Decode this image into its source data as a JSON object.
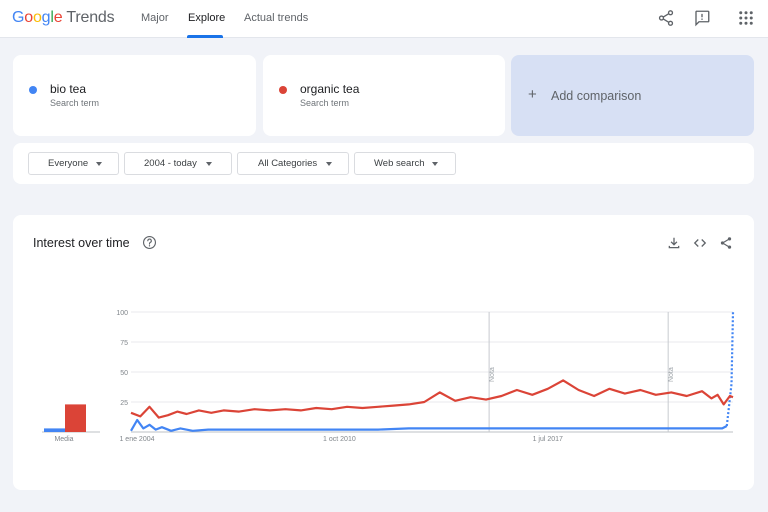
{
  "header": {
    "logo_google": [
      "G",
      "o",
      "o",
      "g",
      "l",
      "e"
    ],
    "logo_trends": "Trends",
    "tabs": [
      "Major",
      "Explore",
      "Actual trends"
    ],
    "active_tab": "Explore",
    "icons": [
      "share-icon",
      "feedback-icon",
      "apps-grid-icon"
    ]
  },
  "terms": [
    {
      "name": "bio tea",
      "sub": "Search term",
      "color": "#4285f4"
    },
    {
      "name": "organic tea",
      "sub": "Search term",
      "color": "#db4437"
    }
  ],
  "add_comparison": {
    "label": "Add comparison",
    "icon": "plus-icon"
  },
  "filters": [
    "Everyone",
    "2004 - today",
    "All Categories",
    "Web search"
  ],
  "chart_card": {
    "title": "Interest over time",
    "icons": [
      "help-icon",
      "download-icon",
      "embed-icon",
      "share-icon"
    ]
  },
  "chart_data": {
    "type": "line",
    "x_tick_labels": [
      "1 ene 2004",
      "1 oct 2010",
      "1 jul 2017"
    ],
    "y_tick_labels": [
      "100",
      "75",
      "50",
      "25"
    ],
    "ylim": [
      0,
      100
    ],
    "xlim": [
      2004.0,
      2023.5
    ],
    "notes": [
      {
        "label": "Nota",
        "x": 2015.6
      },
      {
        "label": "Nota",
        "x": 2021.4
      }
    ],
    "average": {
      "label": "Media",
      "values": [
        3,
        23
      ]
    },
    "series": [
      {
        "name": "bio tea",
        "color": "#4285f4",
        "x": [
          2004.0,
          2004.2,
          2004.4,
          2004.6,
          2004.8,
          2005.0,
          2005.3,
          2005.6,
          2006.0,
          2006.5,
          2007,
          2008,
          2009,
          2010,
          2011,
          2012,
          2013,
          2014,
          2015,
          2016,
          2017,
          2018,
          2019,
          2020,
          2021,
          2022,
          2023.0,
          2023.15,
          2023.3,
          2023.45,
          2023.5
        ],
        "y": [
          1,
          10,
          3,
          6,
          2,
          4,
          1,
          3,
          1,
          2,
          2,
          2,
          2,
          2,
          2,
          2,
          3,
          3,
          3,
          3,
          3,
          3,
          3,
          3,
          3,
          3,
          3,
          3,
          5,
          40,
          100
        ]
      },
      {
        "name": "organic tea",
        "color": "#db4437",
        "x": [
          2004.0,
          2004.3,
          2004.6,
          2004.9,
          2005.2,
          2005.5,
          2005.8,
          2006.2,
          2006.6,
          2007.0,
          2007.5,
          2008.0,
          2008.5,
          2009.0,
          2009.5,
          2010.0,
          2010.5,
          2011.0,
          2011.5,
          2012.0,
          2012.5,
          2013.0,
          2013.5,
          2014.0,
          2014.5,
          2015.0,
          2015.5,
          2016.0,
          2016.5,
          2017.0,
          2017.5,
          2018.0,
          2018.5,
          2019.0,
          2019.5,
          2020.0,
          2020.5,
          2021.0,
          2021.5,
          2022.0,
          2022.5,
          2022.8,
          2023.0,
          2023.2,
          2023.4,
          2023.5
        ],
        "y": [
          16,
          13,
          21,
          12,
          14,
          17,
          15,
          18,
          16,
          18,
          17,
          19,
          18,
          19,
          18,
          20,
          19,
          21,
          20,
          21,
          22,
          23,
          25,
          33,
          26,
          29,
          27,
          30,
          35,
          31,
          36,
          43,
          35,
          30,
          36,
          32,
          35,
          31,
          33,
          30,
          34,
          28,
          31,
          23,
          30,
          29
        ]
      }
    ]
  }
}
